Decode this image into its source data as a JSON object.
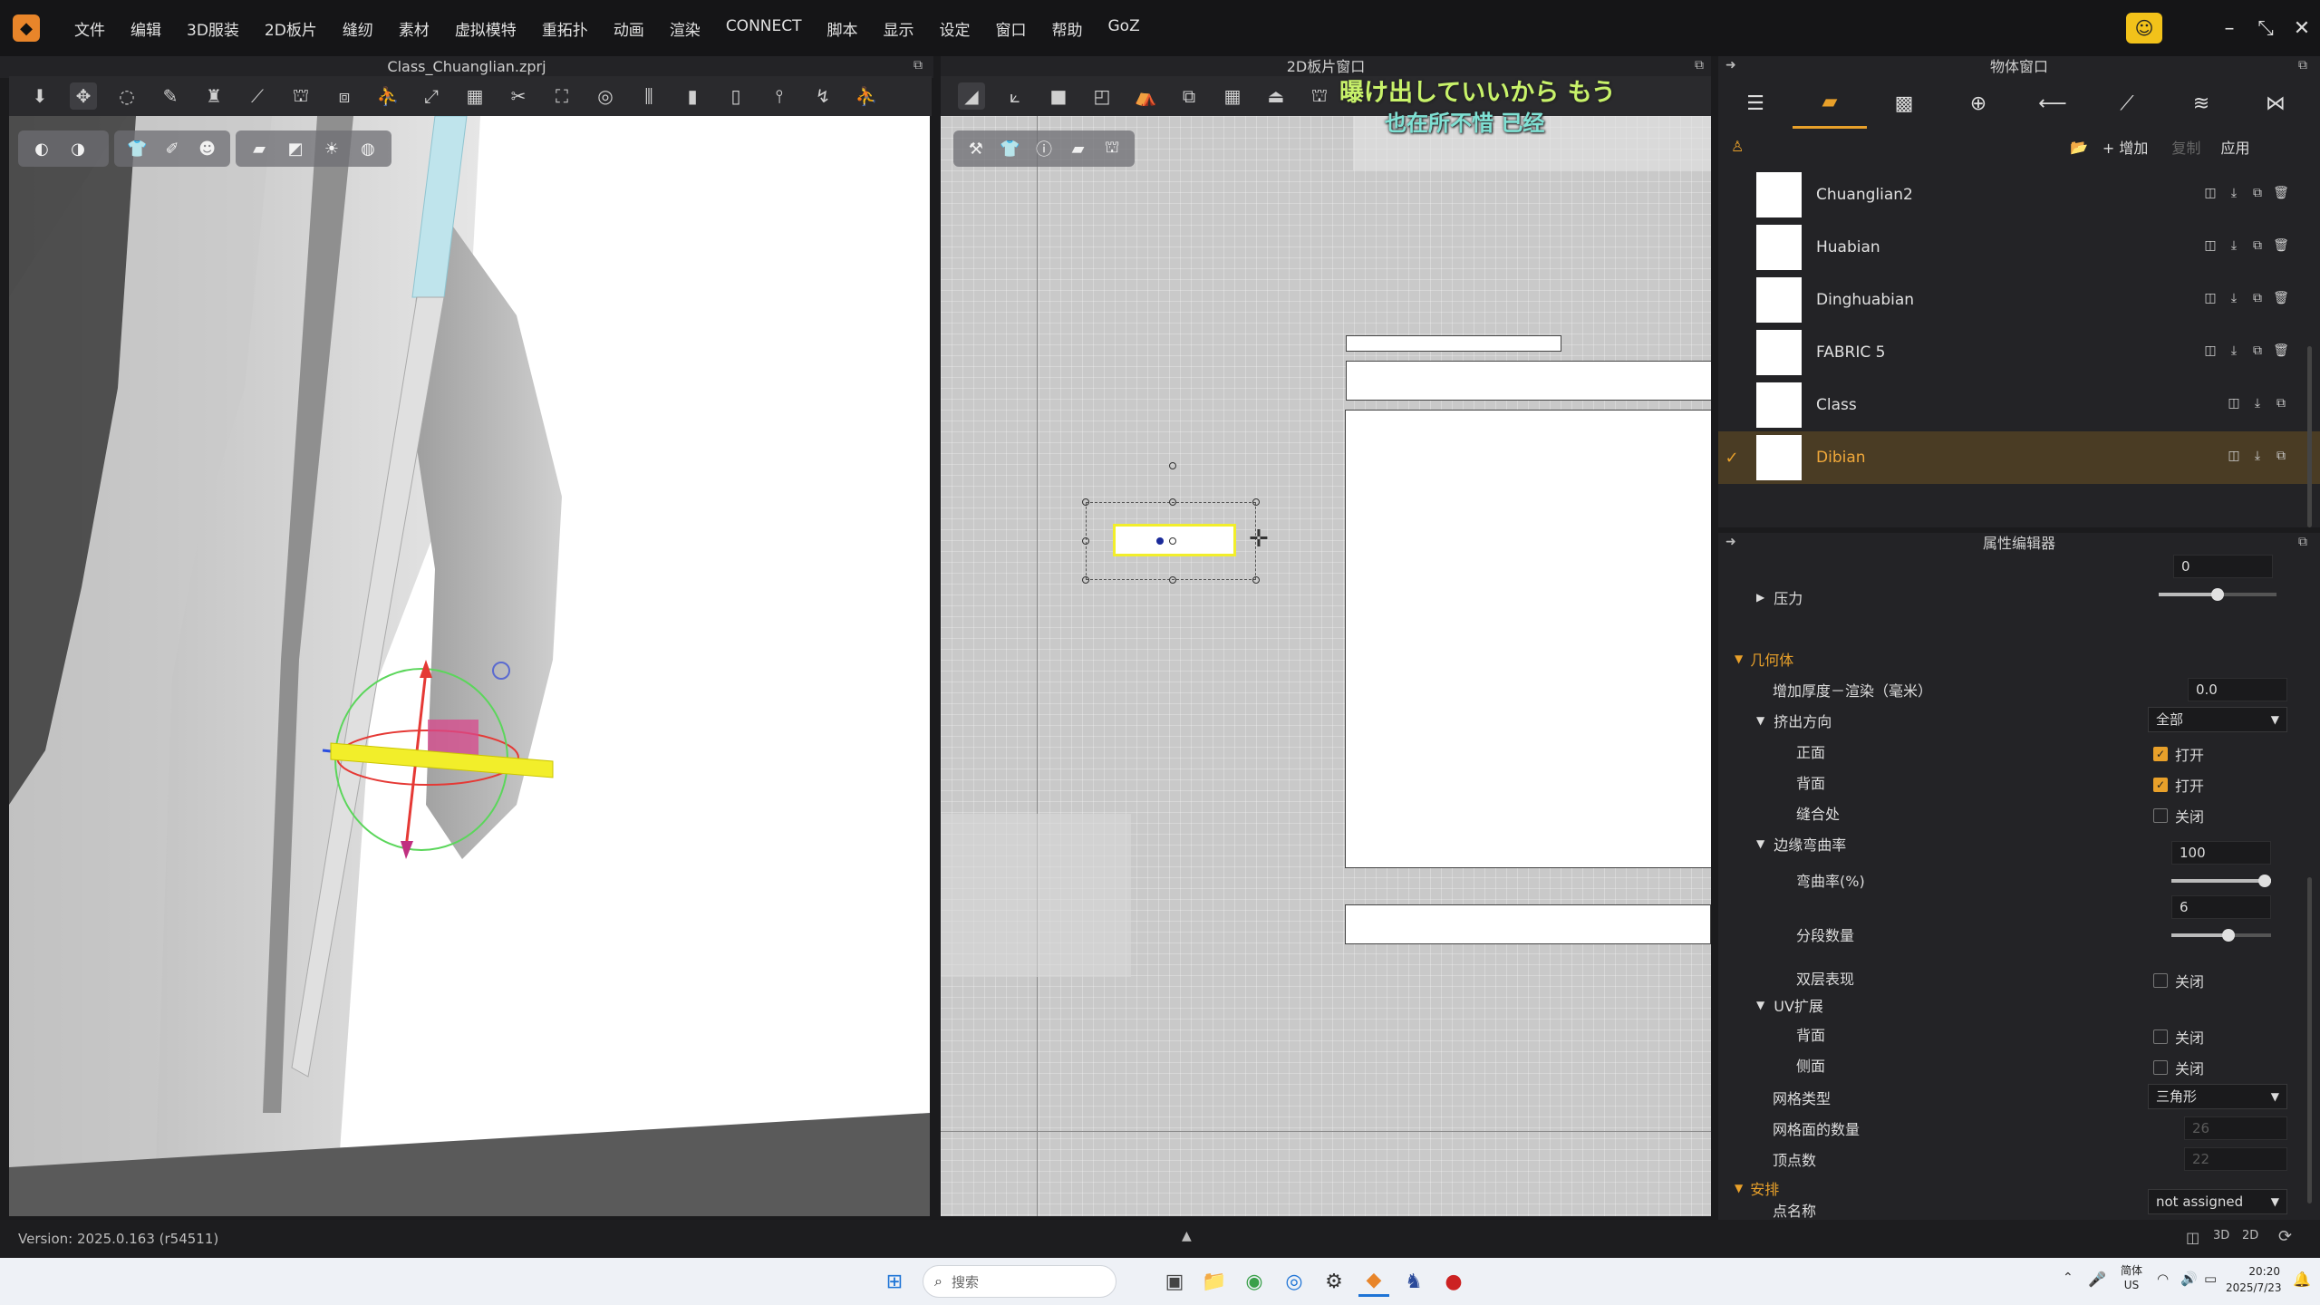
{
  "app": {
    "logo_icon": "clo-logo-icon"
  },
  "menu": [
    "文件",
    "编辑",
    "3D服装",
    "2D板片",
    "缝纫",
    "素材",
    "虚拟模特",
    "重拓扑",
    "动画",
    "渲染",
    "CONNECT",
    "脚本",
    "显示",
    "设定",
    "窗口",
    "帮助",
    "GoZ"
  ],
  "window_controls": {
    "minimize": "–",
    "restore": "⤡",
    "close": "✕"
  },
  "panel3d": {
    "title": "Class_Chuanglian.zprj"
  },
  "panel2d": {
    "title": "2D板片窗口"
  },
  "object_window": {
    "title": "物体窗口",
    "add_label": "+ 增加",
    "copy_label": "复制",
    "apply_label": "应用",
    "fabrics": [
      {
        "name": "Chuanglian2",
        "selected": false
      },
      {
        "name": "Huabian",
        "selected": false
      },
      {
        "name": "Dinghuabian",
        "selected": false
      },
      {
        "name": "FABRIC 5",
        "selected": false
      },
      {
        "name": "Class",
        "selected": false
      },
      {
        "name": "Dibian",
        "selected": true
      }
    ]
  },
  "property_editor": {
    "title": "属性编辑器",
    "pressure": {
      "label": "压力",
      "value": "0",
      "slider": 0.5
    },
    "geometry": {
      "label": "几何体"
    },
    "thickness": {
      "label": "增加厚度－渲染（毫米）",
      "value": "0.0"
    },
    "extrude": {
      "label": "挤出方向",
      "value": "全部"
    },
    "front": {
      "label": "正面",
      "state": "打开"
    },
    "back": {
      "label": "背面",
      "state": "打开"
    },
    "seam": {
      "label": "缝合处",
      "state": "关闭"
    },
    "edge_curve": {
      "label": "边缘弯曲率"
    },
    "curvature": {
      "label": "弯曲率(%)",
      "value": "100",
      "slider": 1.0
    },
    "segments": {
      "label": "分段数量",
      "value": "6",
      "slider": 0.55
    },
    "double_layer": {
      "label": "双层表现",
      "state": "关闭"
    },
    "uv": {
      "label": "UV扩展"
    },
    "uv_back": {
      "label": "背面",
      "state": "关闭"
    },
    "uv_side": {
      "label": "侧面",
      "state": "关闭"
    },
    "mesh_type": {
      "label": "网格类型",
      "value": "三角形"
    },
    "mesh_faces": {
      "label": "网格面的数量",
      "value": "26"
    },
    "vertices": {
      "label": "顶点数",
      "value": "22"
    },
    "arrange": {
      "label": "安排"
    },
    "point_name": {
      "label": "点名称",
      "value": "not assigned"
    }
  },
  "status": {
    "version": "Version: 2025.0.163 (r54511)"
  },
  "subtitles": {
    "line1": "曝け出していいから もう",
    "line2": "也在所不惜 已经"
  },
  "taskbar": {
    "search_placeholder": "搜索",
    "ime": "简体",
    "ime_sub": "US",
    "time": "20:20",
    "date": "2025/7/23"
  },
  "colors": {
    "accent": "#e8a02a",
    "selection": "#4a3c24",
    "highlight_yellow": "#f2ee2a"
  }
}
